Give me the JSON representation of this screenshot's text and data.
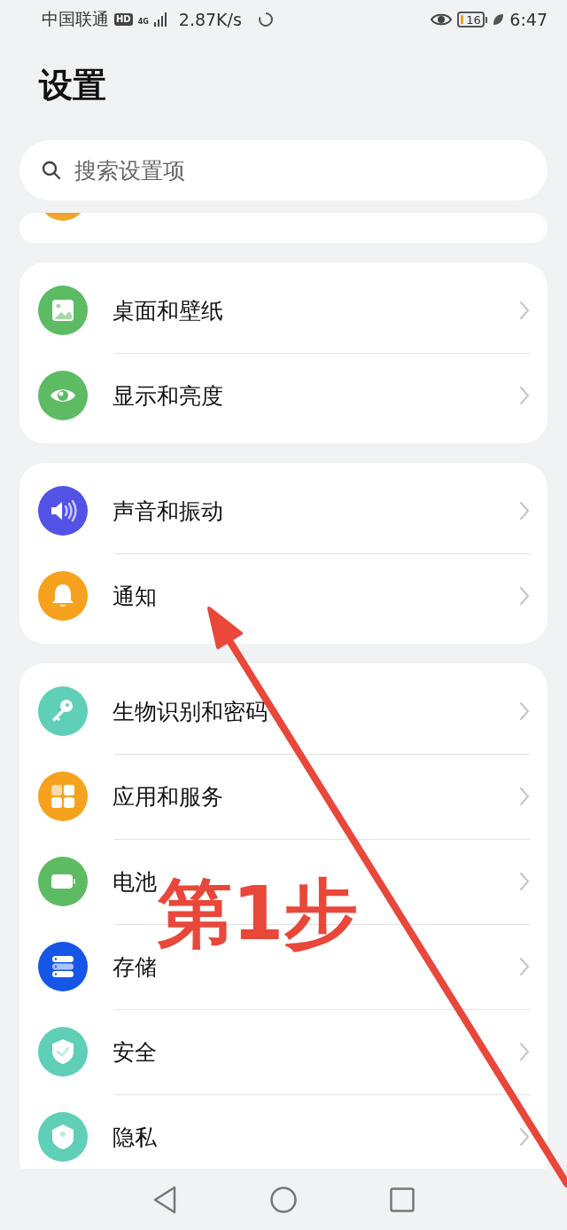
{
  "status_bar": {
    "carrier": "中国联通",
    "hd_badge": "HD",
    "network_type": "4G",
    "speed": "2.87K/s",
    "battery": "16",
    "time": "6:47"
  },
  "title": "设置",
  "search": {
    "placeholder": "搜索设置项"
  },
  "groups": [
    {
      "items": [
        {
          "kind": "partial",
          "color": "#f3a42a"
        }
      ]
    },
    {
      "items": [
        {
          "kind": "wallpaper",
          "label": "桌面和壁纸",
          "color": "#5cbb63"
        },
        {
          "kind": "display",
          "label": "显示和亮度",
          "color": "#5cbb63"
        }
      ]
    },
    {
      "items": [
        {
          "kind": "sound",
          "label": "声音和振动",
          "color": "#5352e6"
        },
        {
          "kind": "bell",
          "label": "通知",
          "color": "#f6a21e"
        }
      ]
    },
    {
      "items": [
        {
          "kind": "key",
          "label": "生物识别和密码",
          "color": "#5fcfb7"
        },
        {
          "kind": "apps",
          "label": "应用和服务",
          "color": "#f6a21e"
        },
        {
          "kind": "battery",
          "label": "电池",
          "color": "#5cbb63"
        },
        {
          "kind": "storage",
          "label": "存储",
          "color": "#1656e6"
        },
        {
          "kind": "shield",
          "label": "安全",
          "color": "#5fcfb7"
        },
        {
          "kind": "privacy",
          "label": "隐私",
          "color": "#5fcfb7"
        }
      ]
    }
  ],
  "annotation": {
    "label": "第1步"
  }
}
